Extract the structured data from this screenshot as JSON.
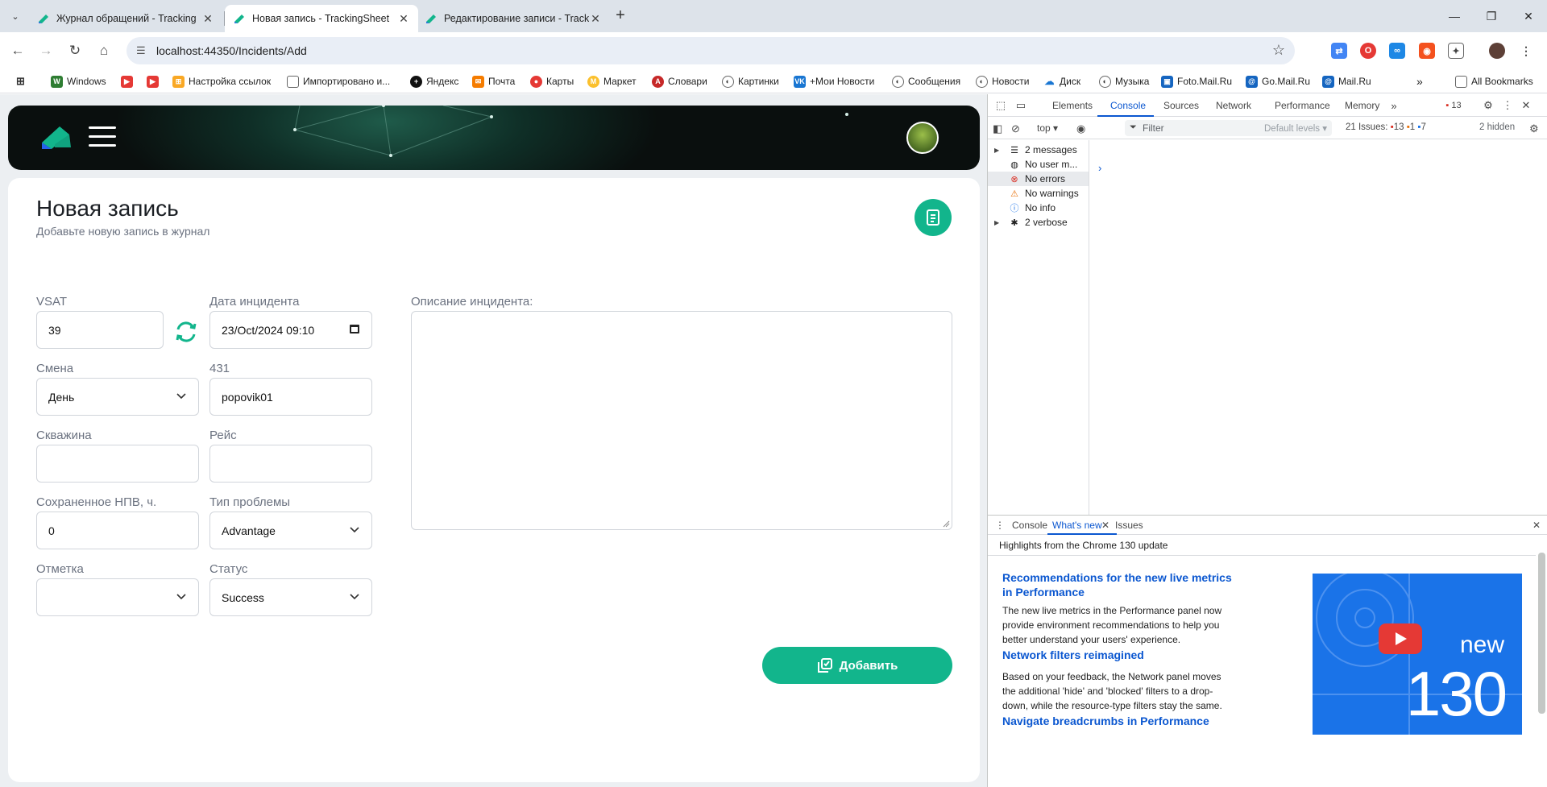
{
  "browser": {
    "tabs": [
      {
        "title": "Журнал обращений - Tracking",
        "active": false
      },
      {
        "title": "Новая запись - TrackingSheet",
        "active": true
      },
      {
        "title": "Редактирование записи - Track",
        "active": false
      }
    ],
    "url": "localhost:44350/Incidents/Add",
    "bookmarks": [
      "Windows",
      "Настройка ссылок",
      "Импортировано и...",
      "Яндекс",
      "Почта",
      "Карты",
      "Маркет",
      "Словари",
      "Картинки",
      "+Мои Новости",
      "Сообщения",
      "Новости",
      "Диск",
      "Музыка",
      "Foto.Mail.Ru",
      "Go.Mail.Ru",
      "Mail.Ru"
    ],
    "all_bookmarks": "All Bookmarks"
  },
  "page": {
    "title": "Новая запись",
    "subtitle": "Добавьте новую запись в журнал",
    "fields": {
      "vsat": {
        "label": "VSAT",
        "value": "39"
      },
      "date": {
        "label": "Дата инцидента",
        "value": "23/Oct/2024 09:10"
      },
      "description": {
        "label": "Описание инцидента:"
      },
      "shift": {
        "label": "Смена",
        "value": "День"
      },
      "operator": {
        "label": "431",
        "value": "popovik01"
      },
      "well": {
        "label": "Скважина",
        "value": ""
      },
      "flight": {
        "label": "Рейс",
        "value": ""
      },
      "npv": {
        "label": "Сохраненное НПВ, ч.",
        "value": "0"
      },
      "problem_type": {
        "label": "Тип проблемы",
        "value": "Advantage"
      },
      "mark": {
        "label": "Отметка",
        "value": ""
      },
      "status": {
        "label": "Статус",
        "value": "Success"
      }
    },
    "submit_label": "Добавить",
    "accent": "#12b58c"
  },
  "devtools": {
    "tabs": [
      "Elements",
      "Console",
      "Sources",
      "Network",
      "Performance",
      "Memory"
    ],
    "active_tab": "Console",
    "issues_badge": "13",
    "context": "top",
    "filter_placeholder": "Filter",
    "levels": "Default levels",
    "issues_summary": "21 Issues:",
    "issue_counts": [
      "13",
      "1",
      "7"
    ],
    "hidden": "2 hidden",
    "sidebar": [
      "2 messages",
      "No user m...",
      "No errors",
      "No warnings",
      "No info",
      "2 verbose"
    ],
    "drawer_tabs": [
      "Console",
      "What's new",
      "Issues"
    ],
    "highlights": "Highlights from the Chrome 130 update",
    "whats_new": [
      {
        "title": "Recommendations for the new live metrics in Performance",
        "text": "The new live metrics in the Performance panel now provide environment recommendations to help you better understand your users' experience."
      },
      {
        "title": "Network filters reimagined",
        "text": "Based on your feedback, the Network panel moves the additional 'hide' and 'blocked' filters to a drop-down, while the resource-type filters stay the same."
      },
      {
        "title": "Navigate breadcrumbs in Performance",
        "text": ""
      }
    ],
    "promo_new": "new",
    "promo_version": "130"
  }
}
